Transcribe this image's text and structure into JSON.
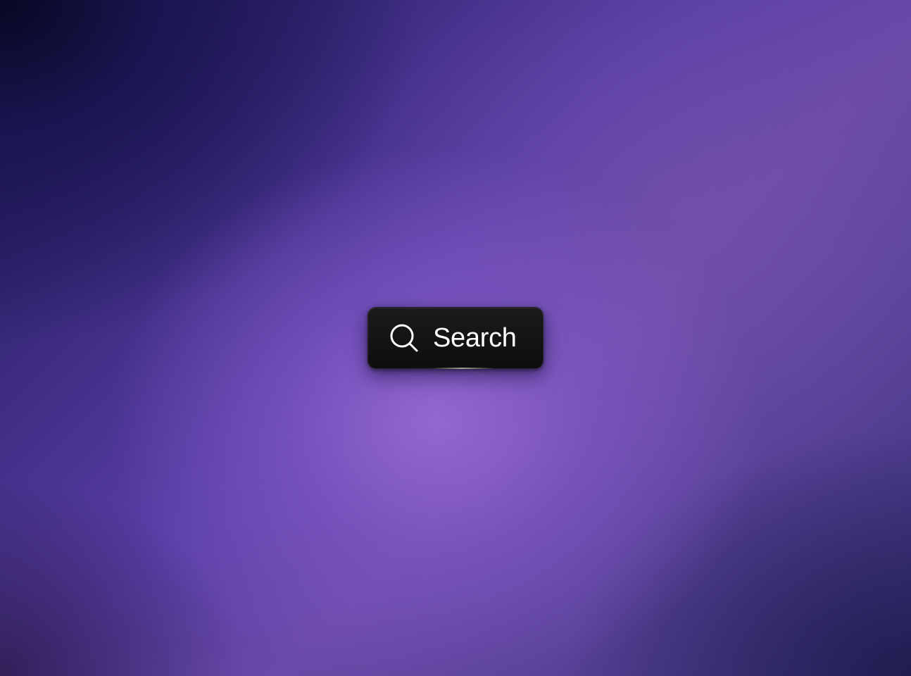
{
  "background": {
    "colors": [
      "#0a0a2e",
      "#3a2d8f",
      "#8a63c8",
      "#26245e"
    ]
  },
  "search_button": {
    "label": "Search",
    "icon": "search-icon",
    "background_color": "#0e0e10",
    "text_color": "#ffffff"
  }
}
